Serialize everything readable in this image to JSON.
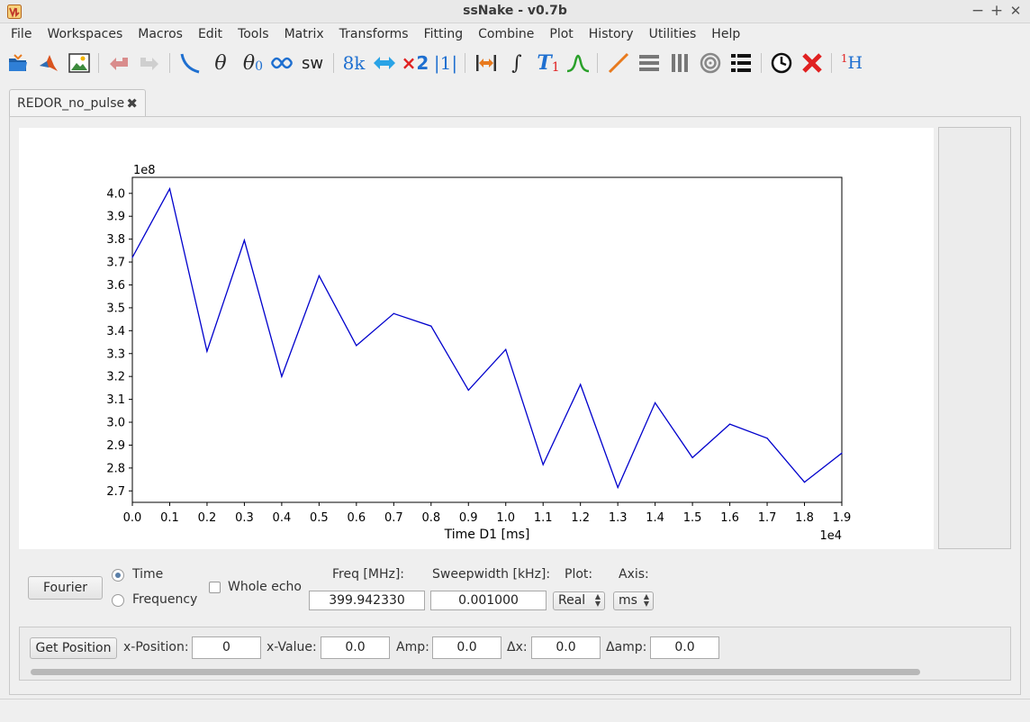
{
  "window": {
    "title": "ssNake - v0.7b",
    "minimize": "−",
    "maximize": "+",
    "close": "✕"
  },
  "menu": [
    "File",
    "Workspaces",
    "Macros",
    "Edit",
    "Tools",
    "Matrix",
    "Transforms",
    "Fitting",
    "Combine",
    "Plot",
    "History",
    "Utilities",
    "Help"
  ],
  "toolbar": {
    "icons": [
      "open-folder-icon",
      "matlab-icon",
      "image-icon",
      "undo-icon",
      "redo-icon",
      "baseline-icon",
      "zero-phase-icon",
      "first-phase-icon",
      "swap-echo-icon",
      "sweepwidth-icon",
      "size-icon",
      "shift-icon",
      "multiply-icon",
      "reference-icon",
      "region-icon",
      "integral-icon",
      "t1-icon",
      "peak-icon",
      "1d-plot-icon",
      "stack-plot-icon",
      "array-plot-icon",
      "contour-icon",
      "multi-plot-icon",
      "clock-icon",
      "close-red-icon",
      "nucleus-icon"
    ],
    "text": {
      "sw": "sw",
      "size": "8k",
      "mult": "×2",
      "ref": "|1|",
      "t1": "T",
      "t1sub": "1",
      "theta": "θ",
      "theta0": "θ",
      "theta0sub": "0",
      "integral": "∫",
      "nuc_sup": "1",
      "nuc": "H"
    }
  },
  "tab": {
    "label": "REDOR_no_pulse",
    "close": "✖"
  },
  "chart_data": {
    "type": "line",
    "x": [
      0,
      1000,
      2000,
      3000,
      4000,
      5000,
      6000,
      7000,
      8000,
      9000,
      10000,
      11000,
      12000,
      13000,
      14000,
      15000,
      16000,
      17000,
      18000,
      19000
    ],
    "series": [
      {
        "values": [
          372000000,
          402000000,
          331000000,
          379500000,
          320000000,
          364000000,
          333500000,
          347500000,
          342000000,
          314000000,
          331800000,
          281500000,
          316500000,
          271500000,
          308500000,
          284500000,
          299200000,
          293000000,
          273800000,
          286500000
        ],
        "color": "#0000cc"
      }
    ],
    "xlabel": "Time D1 [ms]",
    "ylabel": "",
    "xlim": [
      0,
      19000
    ],
    "ylim": [
      265000000,
      407000000
    ],
    "x_offset_label": "1e4",
    "y_offset_label": "1e8",
    "xticks": [
      "0.0",
      "0.1",
      "0.2",
      "0.3",
      "0.4",
      "0.5",
      "0.6",
      "0.7",
      "0.8",
      "0.9",
      "1.0",
      "1.1",
      "1.2",
      "1.3",
      "1.4",
      "1.5",
      "1.6",
      "1.7",
      "1.8",
      "1.9"
    ],
    "yticks": [
      "2.7",
      "2.8",
      "2.9",
      "3.0",
      "3.1",
      "3.2",
      "3.3",
      "3.4",
      "3.5",
      "3.6",
      "3.7",
      "3.8",
      "3.9",
      "4.0"
    ],
    "grid": false
  },
  "controls": {
    "fourier_label": "Fourier",
    "time_label": "Time",
    "frequency_label": "Frequency",
    "whole_echo_label": "Whole echo",
    "freq_label": "Freq [MHz]:",
    "freq_value": "399.942330",
    "sweepwidth_label": "Sweepwidth [kHz]:",
    "sweepwidth_value": "0.001000",
    "plot_label": "Plot:",
    "plot_value": "Real",
    "axis_label": "Axis:",
    "axis_value": "ms"
  },
  "position_bar": {
    "get_position_label": "Get Position",
    "x_position_label": "x-Position:",
    "x_position_value": "0",
    "x_value_label": "x-Value:",
    "x_value_value": "0.0",
    "amp_label": "Amp:",
    "amp_value": "0.0",
    "dx_label": "Δx:",
    "dx_value": "0.0",
    "damp_label": "Δamp:",
    "damp_value": "0.0"
  },
  "colors": {
    "line": "#0000cc",
    "accent_blue": "#1e6fd0",
    "orange": "#e87a1e",
    "red": "#e02020",
    "green": "#2aa02a"
  }
}
